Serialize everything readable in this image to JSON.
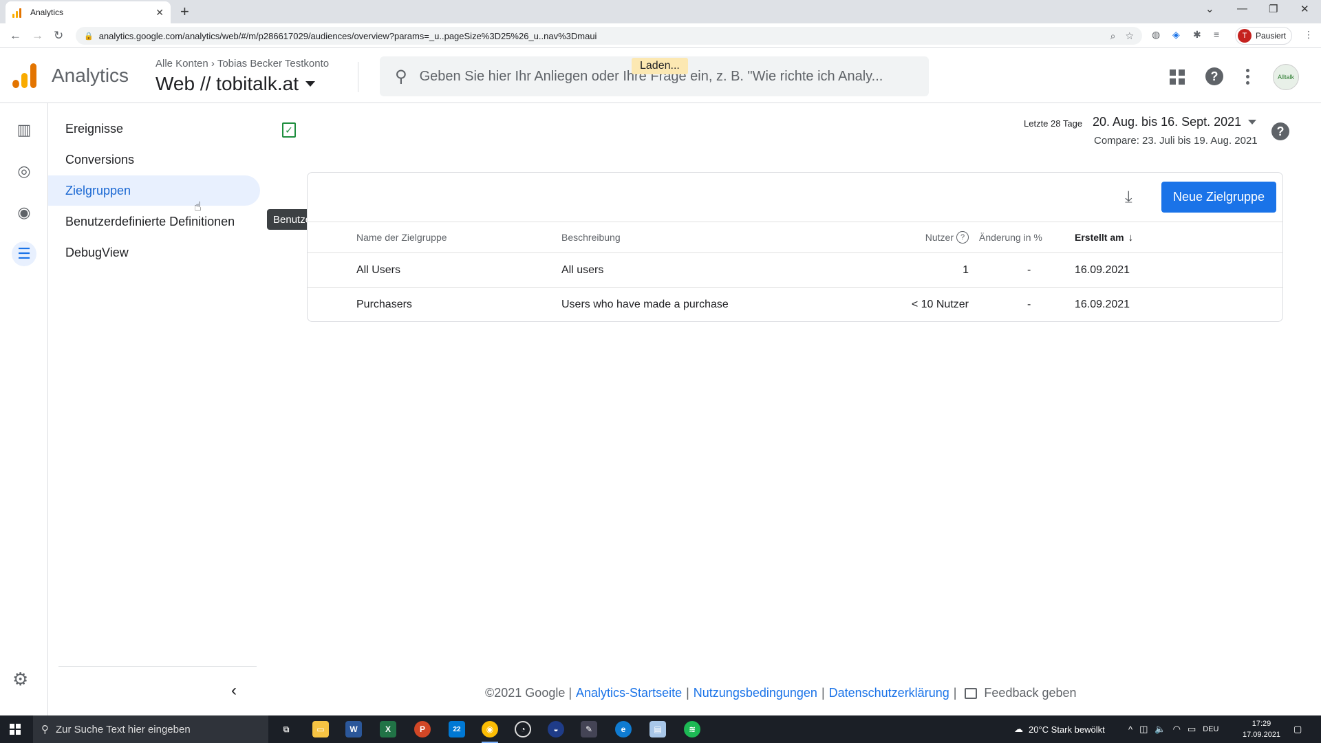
{
  "browser": {
    "tab_title": "Analytics",
    "url": "analytics.google.com/analytics/web/#/m/p286617029/audiences/overview?params=_u..pageSize%3D25%26_u..nav%3Dmaui",
    "profile_label": "Pausiert",
    "profile_initial": "T"
  },
  "header": {
    "product": "Analytics",
    "breadcrumb_account": "Alle Konten",
    "breadcrumb_property": "Tobias Becker Testkonto",
    "property_name": "Web // tobitalk.at",
    "search_placeholder": "Geben Sie hier Ihr Anliegen oder Ihre Frage ein, z. B. \"Wie richte ich Analy...",
    "loading_label": "Laden...",
    "avatar_text": "Alltalk"
  },
  "subnav": {
    "items": [
      {
        "label": "Ereignisse",
        "active": false
      },
      {
        "label": "Conversions",
        "active": false
      },
      {
        "label": "Zielgruppen",
        "active": true
      },
      {
        "label": "Benutzerdefinierte Definitionen",
        "active": false
      },
      {
        "label": "DebugView",
        "active": false
      }
    ],
    "tooltip": "Benutzerdefinierte Definitionen"
  },
  "date": {
    "label": "Letzte 28 Tage",
    "range": "20. Aug. bis 16. Sept. 2021",
    "compare": "Compare: 23. Juli bis 19. Aug. 2021"
  },
  "card": {
    "new_button": "Neue Zielgruppe",
    "columns": {
      "name": "Name der Zielgruppe",
      "description": "Beschreibung",
      "users": "Nutzer",
      "change": "Änderung in %",
      "created": "Erstellt am"
    },
    "rows": [
      {
        "name": "All Users",
        "description": "All users",
        "users": "1",
        "change": "-",
        "created": "16.09.2021"
      },
      {
        "name": "Purchasers",
        "description": "Users who have made a purchase",
        "users": "< 10 Nutzer",
        "change": "-",
        "created": "16.09.2021"
      }
    ]
  },
  "footer": {
    "copyright": "©2021 Google |",
    "link_home": "Analytics-Startseite",
    "sep1": "|",
    "link_terms": "Nutzungsbedingungen",
    "sep2": "|",
    "link_privacy": "Datenschutzerklärung",
    "sep3": "|",
    "feedback": "Feedback geben"
  },
  "taskbar": {
    "search_placeholder": "Zur Suche Text hier eingeben",
    "weather": "20°C  Stark bewölkt",
    "lang": "DEU",
    "time": "17:29",
    "date": "17.09.2021",
    "mail_badge": "22"
  },
  "colors": {
    "accent": "#1a73e8",
    "nav_active_bg": "#e8f0fe",
    "ga_orange": "#f9ab00",
    "ga_dark_orange": "#e37400"
  }
}
